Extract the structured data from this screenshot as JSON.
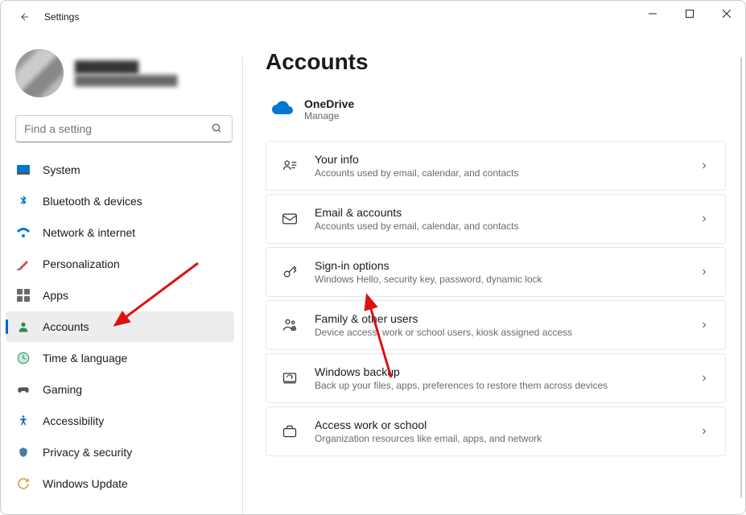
{
  "window": {
    "title": "Settings"
  },
  "profile": {
    "name": "████████",
    "email": "███████████████"
  },
  "search": {
    "placeholder": "Find a setting"
  },
  "sidebar": {
    "items": [
      {
        "label": "System",
        "icon": "system"
      },
      {
        "label": "Bluetooth & devices",
        "icon": "bluetooth"
      },
      {
        "label": "Network & internet",
        "icon": "network"
      },
      {
        "label": "Personalization",
        "icon": "personalization"
      },
      {
        "label": "Apps",
        "icon": "apps"
      },
      {
        "label": "Accounts",
        "icon": "accounts",
        "active": true
      },
      {
        "label": "Time & language",
        "icon": "time"
      },
      {
        "label": "Gaming",
        "icon": "gaming"
      },
      {
        "label": "Accessibility",
        "icon": "accessibility"
      },
      {
        "label": "Privacy & security",
        "icon": "privacy"
      },
      {
        "label": "Windows Update",
        "icon": "update"
      }
    ]
  },
  "main": {
    "title": "Accounts",
    "onedrive": {
      "title": "OneDrive",
      "subtitle": "Manage"
    },
    "cards": [
      {
        "icon": "your-info",
        "title": "Your info",
        "subtitle": "Accounts used by email, calendar, and contacts"
      },
      {
        "icon": "email",
        "title": "Email & accounts",
        "subtitle": "Accounts used by email, calendar, and contacts"
      },
      {
        "icon": "key",
        "title": "Sign-in options",
        "subtitle": "Windows Hello, security key, password, dynamic lock"
      },
      {
        "icon": "family",
        "title": "Family & other users",
        "subtitle": "Device access, work or school users, kiosk assigned access"
      },
      {
        "icon": "backup",
        "title": "Windows backup",
        "subtitle": "Back up your files, apps, preferences to restore them across devices"
      },
      {
        "icon": "work",
        "title": "Access work or school",
        "subtitle": "Organization resources like email, apps, and network"
      }
    ]
  }
}
